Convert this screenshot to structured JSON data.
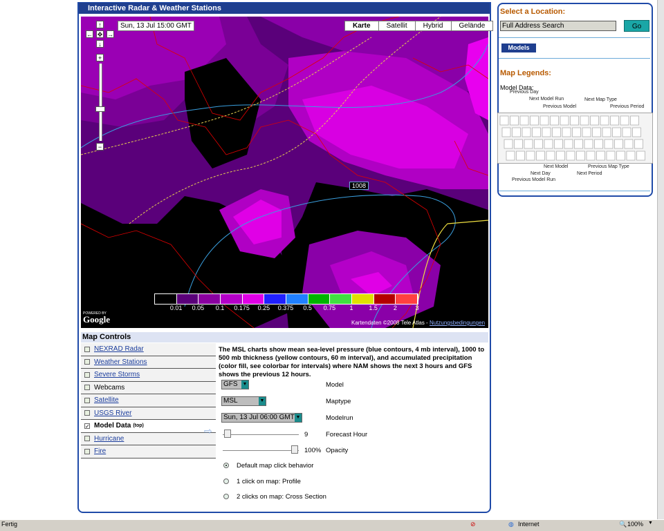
{
  "main": {
    "title": "Interactive Radar & Weather Stations"
  },
  "map": {
    "date": "Sun, 13 Jul 15:00 GMT",
    "map_types": [
      "Karte",
      "Satellit",
      "Hybrid",
      "Gelände"
    ],
    "active_map_type": "Karte",
    "contour_label": "1008",
    "colorbar_labels": [
      "0.01",
      "0.05",
      "0.1",
      "0.175",
      "0.25",
      "0.375",
      "0.5",
      "0.75",
      "1",
      "1.5",
      "2",
      "3"
    ],
    "colorbar_colors": [
      "#000000",
      "#5a007a",
      "#8a00a0",
      "#b400c8",
      "#e000e6",
      "#2020ff",
      "#2080ff",
      "#00b400",
      "#40e040",
      "#e0e000",
      "#b40000",
      "#ff4040"
    ],
    "powered_by": "POWERED BY",
    "google": "Google",
    "attribution": "Kartendaten ©2008 Tele Atlas -",
    "terms_link": "Nutzungsbedingungen"
  },
  "controls": {
    "title": "Map Controls",
    "layers": [
      {
        "label": "NEXRAD Radar",
        "checked": false,
        "link": true
      },
      {
        "label": "Weather Stations",
        "checked": false,
        "link": true
      },
      {
        "label": "Severe Storms",
        "checked": false,
        "link": true
      },
      {
        "label": "Webcams",
        "checked": false,
        "link": false
      },
      {
        "label": "Satellite",
        "checked": false,
        "link": true
      },
      {
        "label": "USGS River",
        "checked": false,
        "link": true
      },
      {
        "label": "Model Data",
        "suffix": "(top)",
        "checked": true,
        "link": false
      },
      {
        "label": "Hurricane",
        "checked": false,
        "link": true
      },
      {
        "label": "Fire",
        "checked": false,
        "link": true
      }
    ],
    "description": "The MSL charts show mean sea-level pressure (blue contours, 4 mb interval), 1000 to 500 mb thickness (yellow contours, 60 m interval), and accumulated precipitation (color fill, see colorbar for intervals) where NAM shows the next 3 hours and GFS shows the previous 12 hours.",
    "model_value": "GFS",
    "model_label": "Model",
    "maptype_value": "MSL",
    "maptype_label": "Maptype",
    "modelrun_value": "Sun, 13 Jul 06:00 GMT",
    "modelrun_label": "Modelrun",
    "forecast_hour_value": "9",
    "forecast_hour_label": "Forecast Hour",
    "opacity_value": "100%",
    "opacity_label": "Opacity",
    "radio_options": [
      "Default map click behavior",
      "1 click on map: Profile",
      "2 clicks on map: Cross Section"
    ],
    "radio_selected": 0
  },
  "side": {
    "select_location": "Select a Location:",
    "address_placeholder": "Full Address Search",
    "go_label": "Go",
    "models_label": "Models",
    "map_legends": "Map Legends:",
    "model_data": "Model Data:",
    "keyboard_labels_top": [
      "Previous Day",
      "Next Model Run",
      "Previous Model",
      "Next Map Type",
      "Previous Period"
    ],
    "keyboard_labels_bottom": [
      "Next Model",
      "Next Day",
      "Previous Model Run",
      "Previous Map Type",
      "Next Period"
    ]
  },
  "status": {
    "left": "Fertig",
    "zone": "Internet",
    "zoom": "100%"
  }
}
